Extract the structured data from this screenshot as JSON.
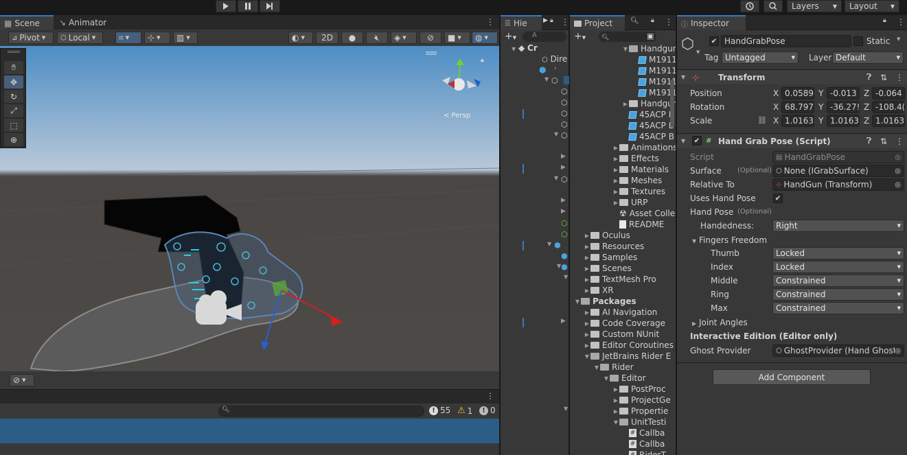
{
  "toolbar": {
    "layers_label": "Layers",
    "layout_label": "Layout",
    "play_icon": "play-icon",
    "pause_icon": "pause-icon",
    "step_icon": "step-icon"
  },
  "scene_panel": {
    "tabs": [
      {
        "label": "Scene"
      },
      {
        "label": "Animator"
      }
    ],
    "pivot_label": "Pivot",
    "local_label": "Local",
    "mode_2d_label": "2D",
    "gizmo_persp_label": "< Persp"
  },
  "console": {
    "count_log": "55",
    "count_warn": "1",
    "count_error": "0"
  },
  "hierarchy": {
    "tab_label": "Hie",
    "search_placeholder": "A",
    "rows": [
      "Cr",
      "Dire",
      "",
      "",
      "",
      "",
      "",
      "",
      "",
      "",
      "",
      "",
      "",
      ""
    ]
  },
  "project": {
    "tab_label": "Project",
    "items": [
      {
        "label": "Handgun",
        "depth": 5,
        "kind": "folder-open",
        "expand": "open"
      },
      {
        "label": "M1911",
        "depth": 6,
        "kind": "prefab",
        "expand": "none"
      },
      {
        "label": "M1911",
        "depth": 6,
        "kind": "prefab",
        "expand": "none"
      },
      {
        "label": "M1911",
        "depth": 6,
        "kind": "prefab",
        "expand": "none"
      },
      {
        "label": "M1911",
        "depth": 6,
        "kind": "prefab",
        "expand": "none"
      },
      {
        "label": "Handgun",
        "depth": 5,
        "kind": "folder",
        "expand": "closed"
      },
      {
        "label": "45ACP B",
        "depth": 5,
        "kind": "prefab",
        "expand": "none"
      },
      {
        "label": "45ACP B",
        "depth": 5,
        "kind": "prefab",
        "expand": "none"
      },
      {
        "label": "45ACP B",
        "depth": 5,
        "kind": "prefab",
        "expand": "none"
      },
      {
        "label": "Animations",
        "depth": 4,
        "kind": "folder",
        "expand": "closed"
      },
      {
        "label": "Effects",
        "depth": 4,
        "kind": "folder",
        "expand": "closed"
      },
      {
        "label": "Materials",
        "depth": 4,
        "kind": "folder",
        "expand": "closed"
      },
      {
        "label": "Meshes",
        "depth": 4,
        "kind": "folder",
        "expand": "closed"
      },
      {
        "label": "Textures",
        "depth": 4,
        "kind": "folder",
        "expand": "closed"
      },
      {
        "label": "URP",
        "depth": 4,
        "kind": "folder",
        "expand": "closed"
      },
      {
        "label": "Asset Collec",
        "depth": 4,
        "kind": "asset",
        "expand": "none"
      },
      {
        "label": "README",
        "depth": 4,
        "kind": "doc",
        "expand": "none"
      },
      {
        "label": "Oculus",
        "depth": 1,
        "kind": "folder",
        "expand": "closed"
      },
      {
        "label": "Resources",
        "depth": 1,
        "kind": "folder",
        "expand": "closed"
      },
      {
        "label": "Samples",
        "depth": 1,
        "kind": "folder",
        "expand": "closed"
      },
      {
        "label": "Scenes",
        "depth": 1,
        "kind": "folder",
        "expand": "closed"
      },
      {
        "label": "TextMesh Pro",
        "depth": 1,
        "kind": "folder",
        "expand": "closed"
      },
      {
        "label": "XR",
        "depth": 1,
        "kind": "folder",
        "expand": "closed"
      },
      {
        "label": "Packages",
        "depth": 0,
        "kind": "folder-open",
        "expand": "open",
        "bold": true
      },
      {
        "label": "AI Navigation",
        "depth": 1,
        "kind": "folder",
        "expand": "closed"
      },
      {
        "label": "Code Coverage",
        "depth": 1,
        "kind": "folder",
        "expand": "closed"
      },
      {
        "label": "Custom NUnit",
        "depth": 1,
        "kind": "folder",
        "expand": "closed"
      },
      {
        "label": "Editor Coroutines",
        "depth": 1,
        "kind": "folder",
        "expand": "closed"
      },
      {
        "label": "JetBrains Rider E",
        "depth": 1,
        "kind": "folder-open",
        "expand": "open"
      },
      {
        "label": "Rider",
        "depth": 2,
        "kind": "folder-open",
        "expand": "open"
      },
      {
        "label": "Editor",
        "depth": 3,
        "kind": "folder-open",
        "expand": "open"
      },
      {
        "label": "PostProc",
        "depth": 4,
        "kind": "folder",
        "expand": "closed"
      },
      {
        "label": "ProjectGe",
        "depth": 4,
        "kind": "folder",
        "expand": "closed"
      },
      {
        "label": "Propertie",
        "depth": 4,
        "kind": "folder",
        "expand": "closed"
      },
      {
        "label": "UnitTesti",
        "depth": 4,
        "kind": "folder-open",
        "expand": "open"
      },
      {
        "label": "Callba",
        "depth": 5,
        "kind": "cs",
        "expand": "none"
      },
      {
        "label": "Callba",
        "depth": 5,
        "kind": "cs",
        "expand": "none"
      },
      {
        "label": "RiderT",
        "depth": 5,
        "kind": "cs",
        "expand": "none"
      }
    ]
  },
  "inspector": {
    "tab_label": "Inspector",
    "object_name": "HandGrabPose",
    "static_label": "Static",
    "tag_label": "Tag",
    "tag_value": "Untagged",
    "layer_label": "Layer",
    "layer_value": "Default",
    "transform": {
      "title": "Transform",
      "position_label": "Position",
      "rotation_label": "Rotation",
      "scale_label": "Scale",
      "position": [
        "0.0589",
        "-0.013",
        "-0.064"
      ],
      "rotation": [
        "68.797",
        "-36.27!",
        "-108.4("
      ],
      "scale": [
        "1.0163:",
        "1.0163:",
        "1.0163:"
      ]
    },
    "script_comp": {
      "title": "Hand Grab Pose (Script)",
      "script_label": "Script",
      "script_value": "HandGrabPose",
      "surface_label": "Surface",
      "optional_label": "(Optional)",
      "surface_value": "None (IGrabSurface)",
      "relative_label": "Relative To",
      "relative_value": "HandGun (Transform)",
      "uses_hand_pose_label": "Uses Hand Pose",
      "hand_pose_label": "Hand Pose",
      "handedness_label": "Handedness:",
      "handedness_value": "Right",
      "fingers_label": "Fingers Freedom",
      "fingers": [
        {
          "label": "Thumb",
          "value": "Locked"
        },
        {
          "label": "Index",
          "value": "Locked"
        },
        {
          "label": "Middle",
          "value": "Constrained"
        },
        {
          "label": "Ring",
          "value": "Constrained"
        },
        {
          "label": "Max",
          "value": "Constrained"
        }
      ],
      "joint_angles_label": "Joint Angles",
      "interactive_label": "Interactive Edition (Editor only)",
      "ghost_label": "Ghost Provider",
      "ghost_value": "GhostProvider (Hand Ghost"
    },
    "add_component_label": "Add Component"
  }
}
